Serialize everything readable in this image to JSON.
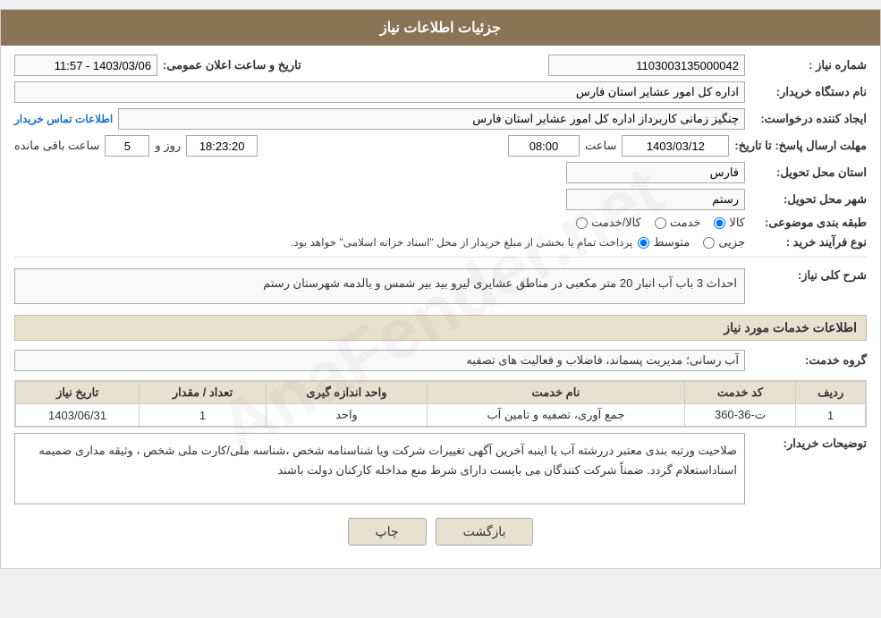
{
  "header": {
    "title": "جزئیات اطلاعات نیاز"
  },
  "fields": {
    "shomara_niaz_label": "شماره نیاز :",
    "shomara_niaz_value": "1103003135000042",
    "tarikh_label": "تاریخ و ساعت اعلان عمومی:",
    "tarikh_value": "1403/03/06 - 11:57",
    "nam_dastgah_label": "نام دستگاه خریدار:",
    "nam_dastgah_value": "اداره کل امور عشایر استان فارس",
    "ijad_label": "ایجاد کننده درخواست:",
    "ijad_value": "چنگیز زمانی کاربرداز اداره کل امور عشایر استان فارس",
    "contact_label": "اطلاعات تماس خریدار",
    "mohlat_label": "مهلت ارسال پاسخ: تا تاریخ:",
    "mohlat_date": "1403/03/12",
    "mohlat_saat_label": "ساعت",
    "mohlat_saat": "08:00",
    "mohlat_rooz_label": "روز و",
    "mohlat_rooz": "5",
    "mohlat_counter_label": "ساعت باقی مانده",
    "mohlat_counter": "18:23:20",
    "ostan_label": "استان محل تحویل:",
    "ostan_value": "فارس",
    "shahr_label": "شهر محل تحویل:",
    "shahr_value": "رستم",
    "tabaqe_label": "طبقه بندی موضوعی:",
    "tabaqe_kala": "کالا",
    "tabaqe_khedmat": "خدمت",
    "tabaqe_kala_khedmat": "کالا/خدمت",
    "nooe_farayand_label": "نوع فرآیند خرید :",
    "nooe_jozvi": "جزیی",
    "nooe_motovaset": "متوسط",
    "nooe_description": "پرداخت تمام یا بخشی از مبلغ خریدار از محل \"اسناد خزانه اسلامی\" خواهد بود.",
    "sharh_label": "شرح کلی نیاز:",
    "sharh_value": "احداث 3 باب آب انبار 20 متر مکعبی در مناطق عشایری لیرو بید بیر شمس و بالدمه شهرستان رستم",
    "khadamat_header": "اطلاعات خدمات مورد نیاز",
    "goroh_label": "گروه خدمت:",
    "goroh_value": "آب رسانی؛ مدیریت پسماند، فاضلاب و فعالیت های تصفیه",
    "table": {
      "headers": [
        "ردیف",
        "کد خدمت",
        "نام خدمت",
        "واحد اندازه گیری",
        "تعداد / مقدار",
        "تاریخ نیاز"
      ],
      "rows": [
        [
          "1",
          "ت-36-360",
          "جمع آوری، تصفیه و تامین آب",
          "واحد",
          "1",
          "1403/06/31"
        ]
      ]
    },
    "notes_label": "توضیحات خریدار:",
    "notes_value": "صلاحیت ورتبه بندی معتبر دررشته آب یا اینبه  آخرین آگهی تغییرات شرکت ویا شناسنامه شخص ،شناسه ملی/کارت ملی شخص ، وثیقه مداری  ضمیمه اسناداستعلام گردد. ضمناً شرکت کنندگان می بایست دارای شرط منع مداخله کارکنان دولت باشند"
  },
  "buttons": {
    "print": "چاپ",
    "back": "بازگشت"
  }
}
